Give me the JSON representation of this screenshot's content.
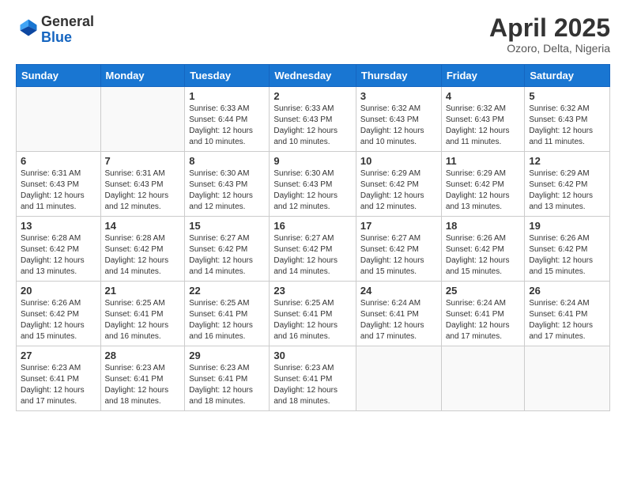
{
  "header": {
    "logo_general": "General",
    "logo_blue": "Blue",
    "title": "April 2025",
    "subtitle": "Ozoro, Delta, Nigeria"
  },
  "calendar": {
    "days_of_week": [
      "Sunday",
      "Monday",
      "Tuesday",
      "Wednesday",
      "Thursday",
      "Friday",
      "Saturday"
    ],
    "weeks": [
      [
        {
          "day": "",
          "info": ""
        },
        {
          "day": "",
          "info": ""
        },
        {
          "day": "1",
          "info": "Sunrise: 6:33 AM\nSunset: 6:44 PM\nDaylight: 12 hours and 10 minutes."
        },
        {
          "day": "2",
          "info": "Sunrise: 6:33 AM\nSunset: 6:43 PM\nDaylight: 12 hours and 10 minutes."
        },
        {
          "day": "3",
          "info": "Sunrise: 6:32 AM\nSunset: 6:43 PM\nDaylight: 12 hours and 10 minutes."
        },
        {
          "day": "4",
          "info": "Sunrise: 6:32 AM\nSunset: 6:43 PM\nDaylight: 12 hours and 11 minutes."
        },
        {
          "day": "5",
          "info": "Sunrise: 6:32 AM\nSunset: 6:43 PM\nDaylight: 12 hours and 11 minutes."
        }
      ],
      [
        {
          "day": "6",
          "info": "Sunrise: 6:31 AM\nSunset: 6:43 PM\nDaylight: 12 hours and 11 minutes."
        },
        {
          "day": "7",
          "info": "Sunrise: 6:31 AM\nSunset: 6:43 PM\nDaylight: 12 hours and 12 minutes."
        },
        {
          "day": "8",
          "info": "Sunrise: 6:30 AM\nSunset: 6:43 PM\nDaylight: 12 hours and 12 minutes."
        },
        {
          "day": "9",
          "info": "Sunrise: 6:30 AM\nSunset: 6:43 PM\nDaylight: 12 hours and 12 minutes."
        },
        {
          "day": "10",
          "info": "Sunrise: 6:29 AM\nSunset: 6:42 PM\nDaylight: 12 hours and 12 minutes."
        },
        {
          "day": "11",
          "info": "Sunrise: 6:29 AM\nSunset: 6:42 PM\nDaylight: 12 hours and 13 minutes."
        },
        {
          "day": "12",
          "info": "Sunrise: 6:29 AM\nSunset: 6:42 PM\nDaylight: 12 hours and 13 minutes."
        }
      ],
      [
        {
          "day": "13",
          "info": "Sunrise: 6:28 AM\nSunset: 6:42 PM\nDaylight: 12 hours and 13 minutes."
        },
        {
          "day": "14",
          "info": "Sunrise: 6:28 AM\nSunset: 6:42 PM\nDaylight: 12 hours and 14 minutes."
        },
        {
          "day": "15",
          "info": "Sunrise: 6:27 AM\nSunset: 6:42 PM\nDaylight: 12 hours and 14 minutes."
        },
        {
          "day": "16",
          "info": "Sunrise: 6:27 AM\nSunset: 6:42 PM\nDaylight: 12 hours and 14 minutes."
        },
        {
          "day": "17",
          "info": "Sunrise: 6:27 AM\nSunset: 6:42 PM\nDaylight: 12 hours and 15 minutes."
        },
        {
          "day": "18",
          "info": "Sunrise: 6:26 AM\nSunset: 6:42 PM\nDaylight: 12 hours and 15 minutes."
        },
        {
          "day": "19",
          "info": "Sunrise: 6:26 AM\nSunset: 6:42 PM\nDaylight: 12 hours and 15 minutes."
        }
      ],
      [
        {
          "day": "20",
          "info": "Sunrise: 6:26 AM\nSunset: 6:42 PM\nDaylight: 12 hours and 15 minutes."
        },
        {
          "day": "21",
          "info": "Sunrise: 6:25 AM\nSunset: 6:41 PM\nDaylight: 12 hours and 16 minutes."
        },
        {
          "day": "22",
          "info": "Sunrise: 6:25 AM\nSunset: 6:41 PM\nDaylight: 12 hours and 16 minutes."
        },
        {
          "day": "23",
          "info": "Sunrise: 6:25 AM\nSunset: 6:41 PM\nDaylight: 12 hours and 16 minutes."
        },
        {
          "day": "24",
          "info": "Sunrise: 6:24 AM\nSunset: 6:41 PM\nDaylight: 12 hours and 17 minutes."
        },
        {
          "day": "25",
          "info": "Sunrise: 6:24 AM\nSunset: 6:41 PM\nDaylight: 12 hours and 17 minutes."
        },
        {
          "day": "26",
          "info": "Sunrise: 6:24 AM\nSunset: 6:41 PM\nDaylight: 12 hours and 17 minutes."
        }
      ],
      [
        {
          "day": "27",
          "info": "Sunrise: 6:23 AM\nSunset: 6:41 PM\nDaylight: 12 hours and 17 minutes."
        },
        {
          "day": "28",
          "info": "Sunrise: 6:23 AM\nSunset: 6:41 PM\nDaylight: 12 hours and 18 minutes."
        },
        {
          "day": "29",
          "info": "Sunrise: 6:23 AM\nSunset: 6:41 PM\nDaylight: 12 hours and 18 minutes."
        },
        {
          "day": "30",
          "info": "Sunrise: 6:23 AM\nSunset: 6:41 PM\nDaylight: 12 hours and 18 minutes."
        },
        {
          "day": "",
          "info": ""
        },
        {
          "day": "",
          "info": ""
        },
        {
          "day": "",
          "info": ""
        }
      ]
    ]
  }
}
